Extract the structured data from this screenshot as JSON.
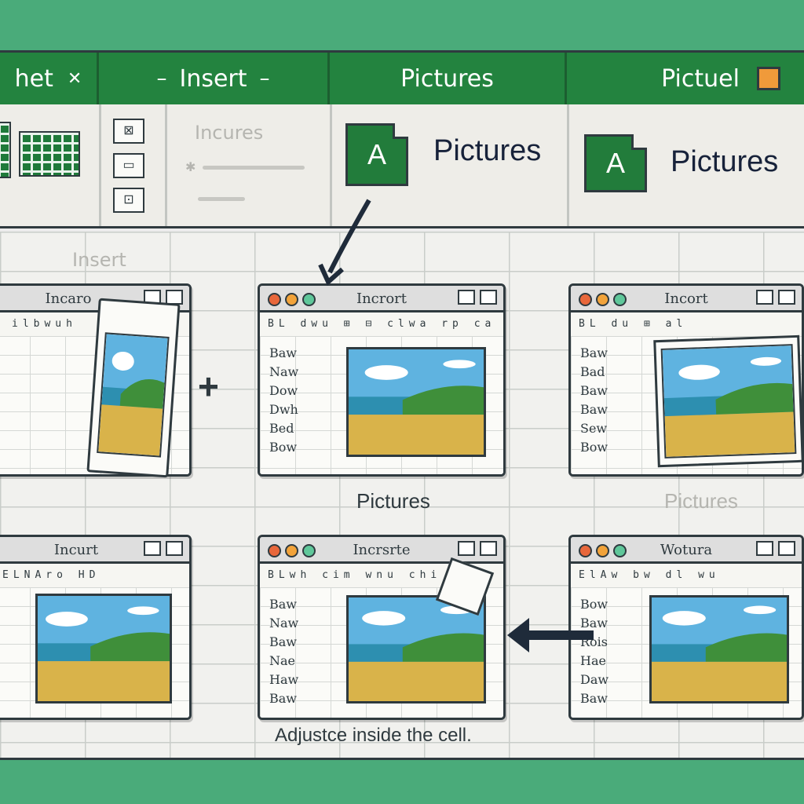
{
  "tabs": [
    {
      "label": "het",
      "mark": "✕"
    },
    {
      "label": "Insert"
    },
    {
      "label": "Pictures"
    },
    {
      "label": "Pictuel"
    }
  ],
  "ribbon": {
    "faint_label": "Incures",
    "faint_label_2": "Insert",
    "icon_letter": "A",
    "label_1": "Pictures",
    "label_2": "Pictures"
  },
  "windows": [
    {
      "title": "Incaro",
      "tools": "ilbwuh",
      "rows": []
    },
    {
      "title": "Incrort",
      "tools": "BL dwu ⊞ ⊟ clwa rp ca",
      "rows": [
        "Baw",
        "Naw",
        "Dow",
        "Dwh",
        "Bed",
        "Bow"
      ]
    },
    {
      "title": "Incort",
      "tools": "BL du ⊞ al",
      "rows": [
        "Baw",
        "Bad",
        "Baw",
        "Baw",
        "Sew",
        "Bow"
      ]
    },
    {
      "title": "Incurt",
      "tools": "ELNAro HD",
      "rows": []
    },
    {
      "title": "Incrsrte",
      "tools": "BLwh cim wnu chi",
      "rows": [
        "Baw",
        "Naw",
        "Baw",
        "Nae",
        "Haw",
        "Baw"
      ]
    },
    {
      "title": "Wotura",
      "tools": "ElAw bw dl wu",
      "rows": [
        "Bow",
        "Baw",
        "Rois",
        "Hae",
        "Daw",
        "Baw"
      ]
    }
  ],
  "plus": "+",
  "captions": {
    "pictures_mid": "Pictures",
    "pictures_right": "Pictures",
    "bottom": "Adjustce inside the cell."
  },
  "colors": {
    "background": "#4aab7a",
    "tabbar": "#23833f",
    "accent_orange": "#f09a3a",
    "cell_orange": "#ee6a2c"
  }
}
